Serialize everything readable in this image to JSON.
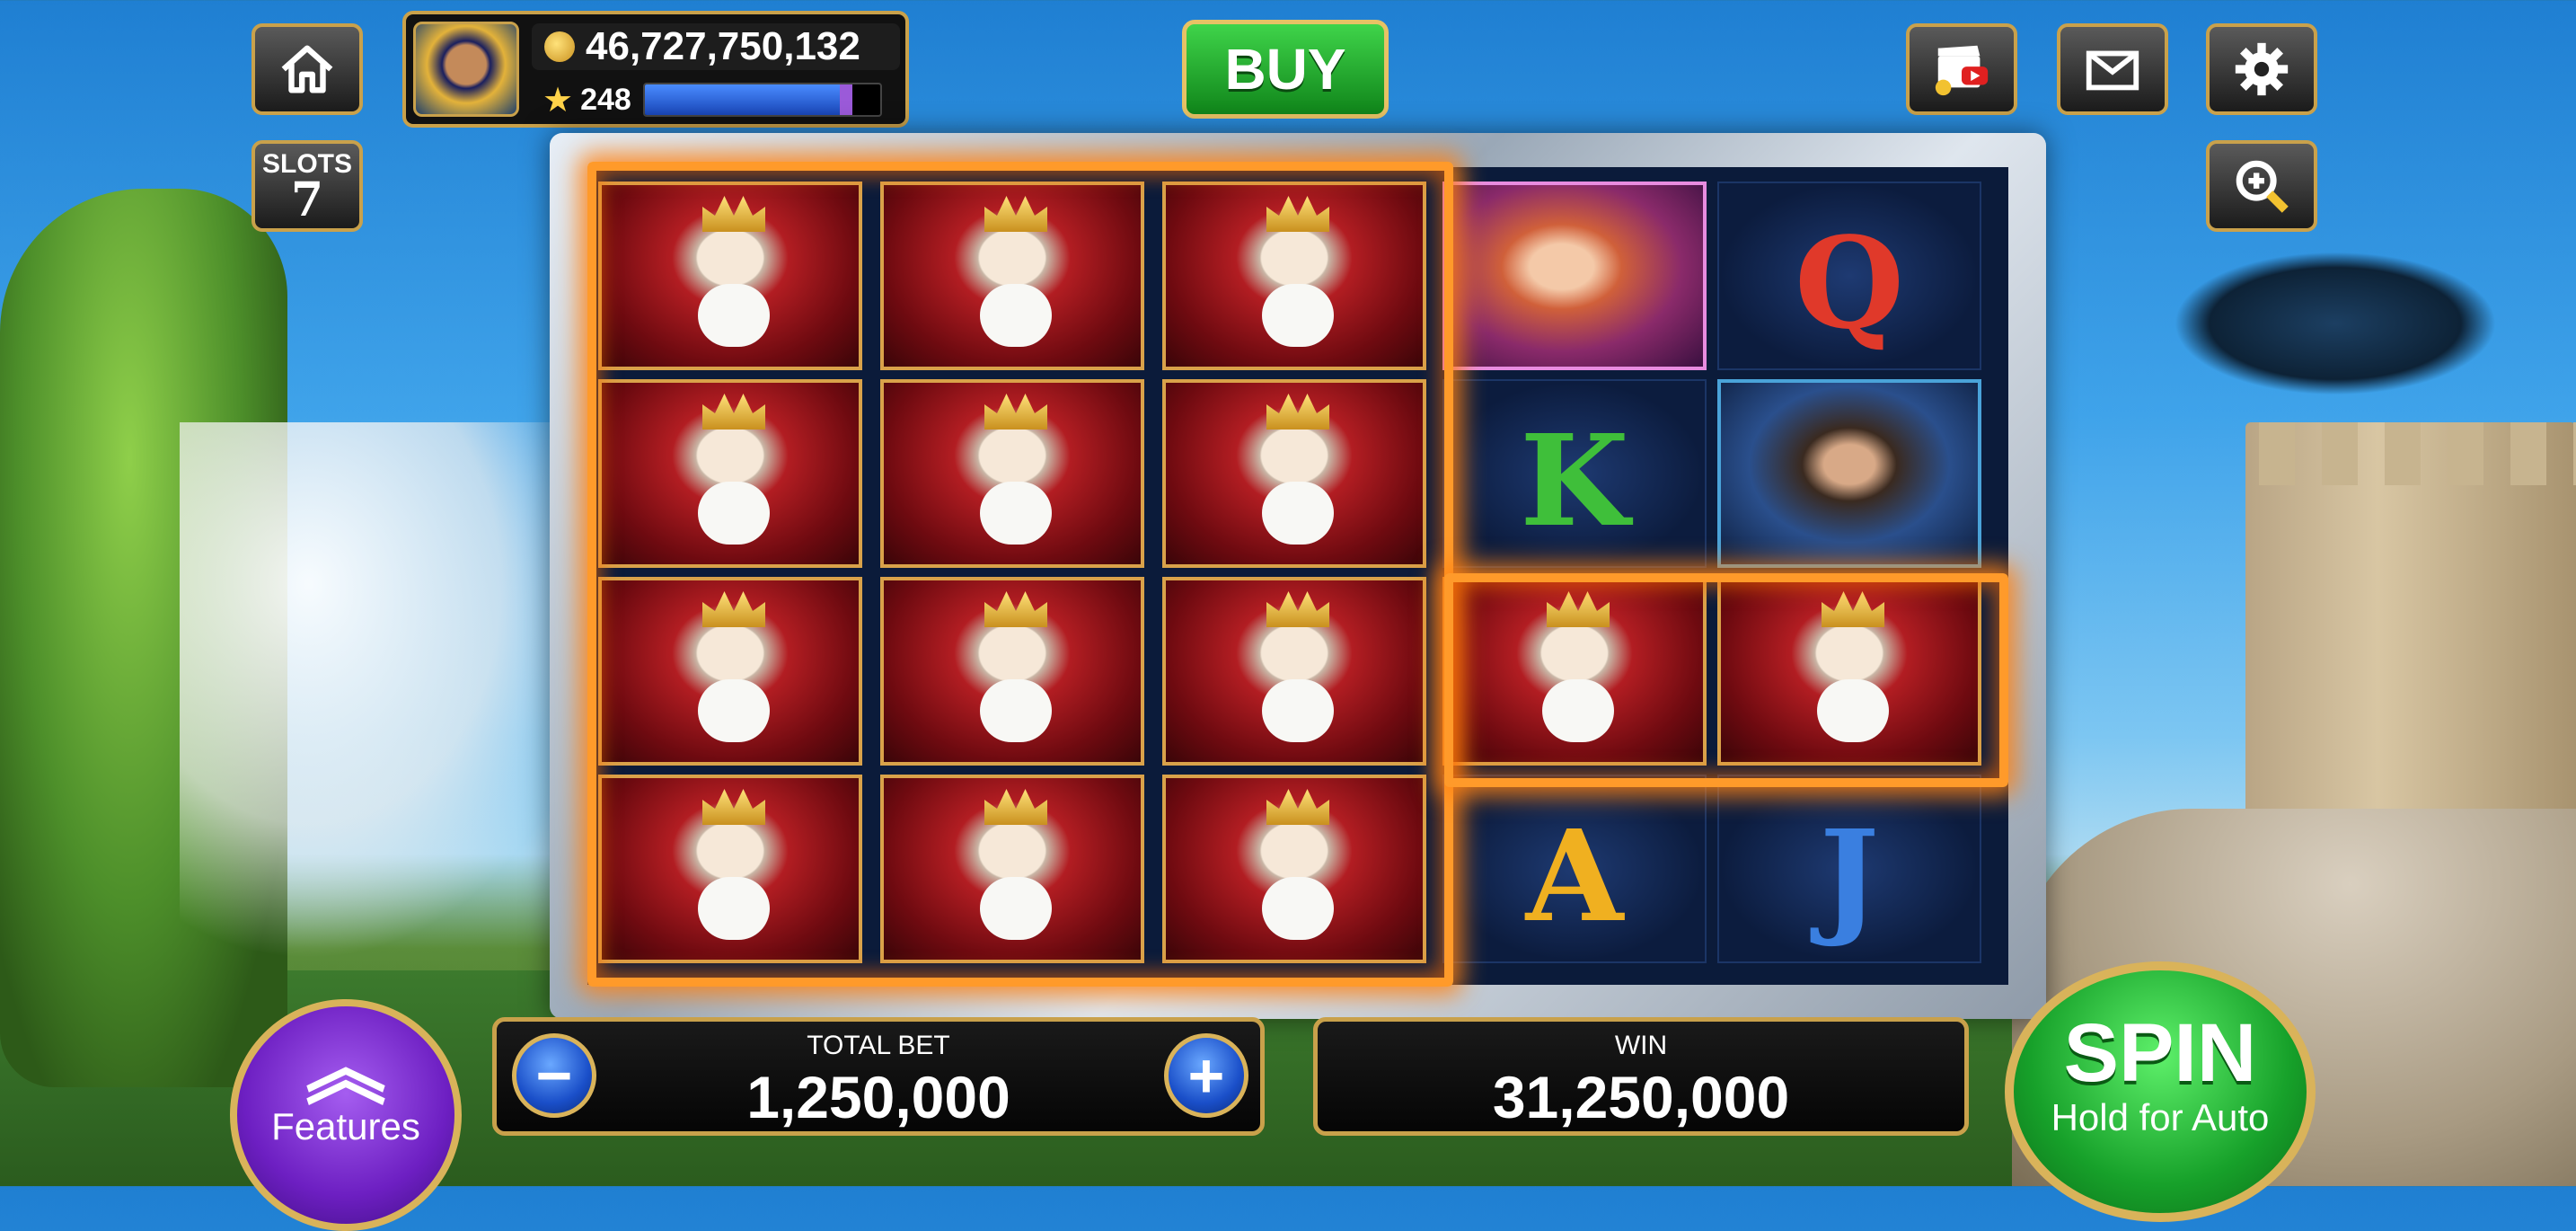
{
  "top_bar": {
    "home_label": "",
    "slots_label_line1": "SLOTS",
    "slots_label_line2": "7",
    "coins": "46,727,750,132",
    "level": "248",
    "xp_progress_fraction": 0.88,
    "buy_label": "BUY"
  },
  "reels": {
    "columns": [
      [
        "king",
        "king",
        "king",
        "king"
      ],
      [
        "king",
        "king",
        "king",
        "king"
      ],
      [
        "king",
        "king",
        "king",
        "king"
      ],
      [
        "lady",
        "K",
        "king",
        "A"
      ],
      [
        "Q",
        "hero",
        "king",
        "J"
      ]
    ],
    "card_letters": {
      "K": "K",
      "Q": "Q",
      "A": "A",
      "J": "J"
    },
    "winning_highlight": "king-symbols"
  },
  "bottom_bar": {
    "features_label": "Features",
    "total_bet_label": "TOTAL BET",
    "total_bet_value": "1,250,000",
    "minus_label": "−",
    "plus_label": "+",
    "win_label": "WIN",
    "win_value": "31,250,000",
    "spin_label": "SPIN",
    "spin_sublabel": "Hold for Auto"
  },
  "colors": {
    "accent_gold": "#c9a14b",
    "buy_green": "#1fae2a",
    "features_purple": "#7a2ad1",
    "fire_orange": "#ff9a2a"
  },
  "icons": [
    "home-icon",
    "video-icon",
    "mail-icon",
    "gear-icon",
    "zoom-in-icon",
    "coin-icon",
    "star-icon",
    "chevron-up-icon"
  ]
}
